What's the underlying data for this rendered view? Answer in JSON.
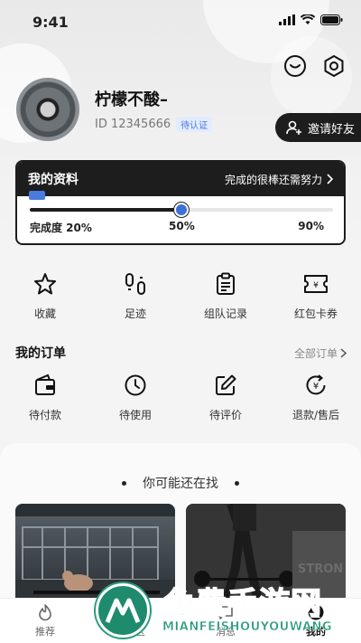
{
  "status_bar": {
    "time": "9:41"
  },
  "user": {
    "name": "柠檬不酸–",
    "id": "ID 12345666",
    "badge": "待认证"
  },
  "invite": {
    "label": "邀请好友"
  },
  "profile_card": {
    "title": "我的资料",
    "link": "完成的很棒还需努力",
    "progress": 0.5,
    "start_label": "完成度 20%",
    "mid_label": "50%",
    "end_label": "90%"
  },
  "quick_actions": [
    {
      "label": "收藏",
      "icon": "star-icon"
    },
    {
      "label": "足迹",
      "icon": "footprints-icon"
    },
    {
      "label": "组队记录",
      "icon": "clipboard-icon"
    },
    {
      "label": "红包卡券",
      "icon": "ticket-icon"
    }
  ],
  "orders": {
    "title": "我的订单",
    "all_link": "全部订单",
    "items": [
      {
        "label": "待付款",
        "icon": "wallet-icon"
      },
      {
        "label": "待使用",
        "icon": "clock-icon"
      },
      {
        "label": "待评价",
        "icon": "edit-icon"
      },
      {
        "label": "退款/售后",
        "icon": "refund-icon"
      }
    ]
  },
  "recommend": {
    "title": "你可能还在找"
  },
  "tabbar": [
    {
      "label": "推荐",
      "icon": "flame-icon"
    },
    {
      "label": "社区",
      "icon": "community-icon"
    },
    {
      "label": "消息",
      "icon": "message-icon"
    },
    {
      "label": "我的",
      "icon": "profile-icon",
      "active": true
    }
  ],
  "watermark": {
    "cn": "免费手游网",
    "en": "MIANFEISHOUYOUWANG"
  },
  "colors": {
    "dark": "#1d1d1d",
    "accent": "#3c6fd8",
    "badge_bg": "#e3ecff",
    "watermark": "#2a9b7c"
  }
}
